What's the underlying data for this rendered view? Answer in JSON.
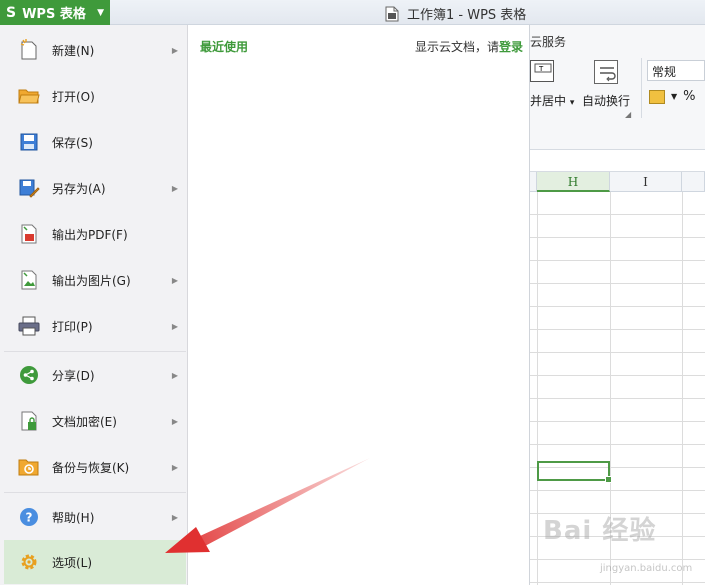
{
  "titlebar": {
    "app_button": "WPS 表格",
    "app_logo": "S",
    "doc_title": "工作簿1 - WPS 表格"
  },
  "ribbon": {
    "tab_partial": "云服务",
    "merge_center_label": "并居中",
    "merge_arrow": "▾",
    "wrap_text_label": "自动换行",
    "number_format": "常规",
    "percent": "%"
  },
  "sheet": {
    "columns": [
      "H",
      "I"
    ],
    "selected_column": "H"
  },
  "menu": {
    "items": [
      {
        "label": "新建(N)",
        "icon": "new-document-icon",
        "submenu": true
      },
      {
        "label": "打开(O)",
        "icon": "open-folder-icon",
        "submenu": false
      },
      {
        "label": "保存(S)",
        "icon": "save-disk-icon",
        "submenu": false
      },
      {
        "label": "另存为(A)",
        "icon": "save-as-icon",
        "submenu": true
      },
      {
        "label": "输出为PDF(F)",
        "icon": "export-pdf-icon",
        "submenu": false
      },
      {
        "label": "输出为图片(G)",
        "icon": "export-image-icon",
        "submenu": true
      },
      {
        "label": "打印(P)",
        "icon": "printer-icon",
        "submenu": true
      },
      {
        "label": "分享(D)",
        "icon": "share-icon",
        "submenu": true
      },
      {
        "label": "文档加密(E)",
        "icon": "document-lock-icon",
        "submenu": true
      },
      {
        "label": "备份与恢复(K)",
        "icon": "backup-restore-icon",
        "submenu": true
      },
      {
        "label": "帮助(H)",
        "icon": "help-icon",
        "submenu": true
      },
      {
        "label": "选项(L)",
        "icon": "gear-icon",
        "submenu": false
      }
    ],
    "selected": "选项(L)"
  },
  "recent": {
    "title": "最近使用",
    "cloud_prompt": "显示云文档，请",
    "login_link": "登录"
  },
  "watermark": {
    "text": "Bai 经验",
    "sub": "jingyan.baidu.com"
  },
  "colors": {
    "brand_green": "#3f9a3b",
    "selected_bg": "#d9ebd6",
    "arrow_red": "#e03030"
  }
}
